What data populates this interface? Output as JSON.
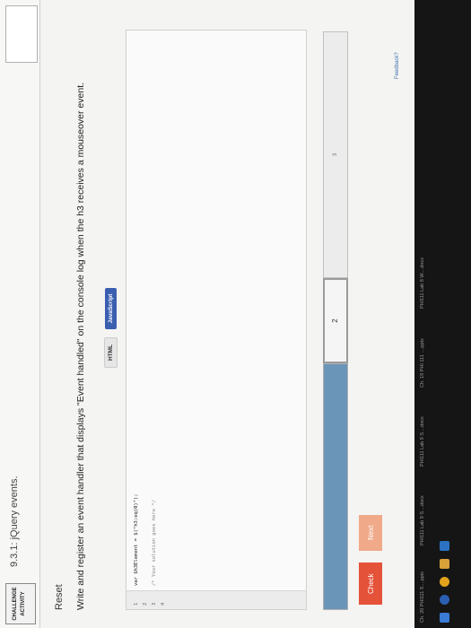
{
  "header": {
    "badge_line1": "CHALLENGE",
    "badge_line2": "ACTIVITY",
    "title": "9.3.1: jQuery events."
  },
  "reset_label": "Reset",
  "prompt": "Write and register an event handler that displays \"Event handled\" on the console log when the h3 receives a mouseover event.",
  "tabs": {
    "html": "HTML",
    "javascript": "JavaScript"
  },
  "editor": {
    "line_numbers": [
      "1",
      "2",
      "3",
      "4"
    ],
    "lines": [
      "var $h3Element = $(\"h3:eq(0)\");",
      "",
      "/* Your solution goes here */",
      ""
    ]
  },
  "progress": {
    "step2": "2",
    "step3": "3"
  },
  "buttons": {
    "check": "Check",
    "next": "Next"
  },
  "feedback": "Feedback?",
  "taskbar": {
    "items": [
      "Ch. 20 PHI111 S....pptx",
      "PHI111 Lab 9 S....docx",
      "PHI111 Lab 9 S....docx",
      "Ch. 19 PHI 111 ....pptx",
      "PHI111 Lab 8 W....docx"
    ]
  }
}
